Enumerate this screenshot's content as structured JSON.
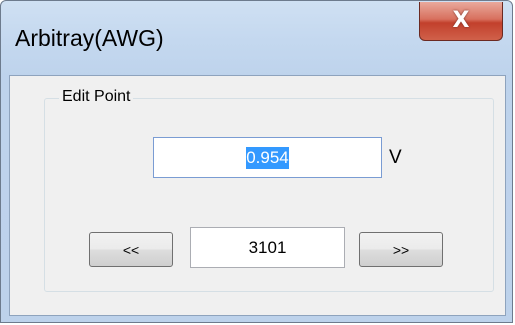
{
  "window": {
    "title": "Arbitray(AWG)",
    "close_glyph": "X",
    "close_icon": "close-icon"
  },
  "edit_point": {
    "group_label": "Edit Point",
    "value": "0.954",
    "unit": "V",
    "prev_label": "<<",
    "next_label": ">>",
    "index": "3101"
  },
  "colors": {
    "selection": "#3399ff",
    "close_button": "#c2402c",
    "titlebar": "#c4d8ef"
  }
}
